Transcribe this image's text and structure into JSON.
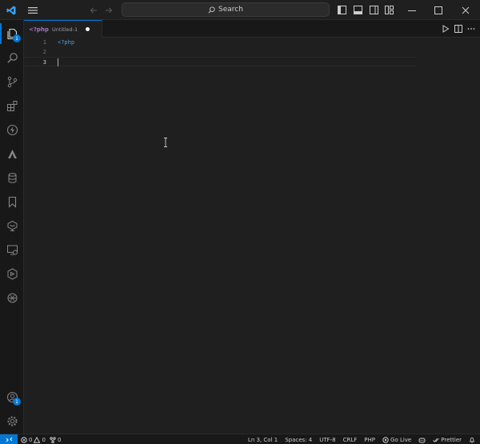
{
  "titlebar": {
    "search_label": "Search",
    "icons": [
      "vscode-logo-icon",
      "menu-icon",
      "back-arrow-icon",
      "forward-arrow-icon",
      "toggle-primary-sidebar-icon",
      "toggle-panel-icon",
      "toggle-secondary-sidebar-icon",
      "customize-layout-icon",
      "minimize-icon",
      "maximize-icon",
      "close-icon"
    ]
  },
  "activitybar": {
    "explorer_badge": "1",
    "accounts_badge": "1",
    "items": [
      "explorer-icon",
      "search-icon",
      "source-control-icon",
      "extensions-icon",
      "thunder-icon",
      "triangle-icon",
      "database-icon",
      "bookmark-icon",
      "cloud-icon",
      "remote-explorer-icon",
      "box-icon",
      "openai-icon",
      "accounts-icon",
      "manage-icon"
    ]
  },
  "tab": {
    "lang": "<?php",
    "title": "Untitled-1",
    "dirty": true
  },
  "editor": {
    "lines": [
      {
        "number": "1",
        "text": "<?php"
      },
      {
        "number": "2",
        "text": ""
      },
      {
        "number": "3",
        "text": ""
      }
    ],
    "current_line": "3"
  },
  "statusbar": {
    "errors": "0",
    "warnings": "0",
    "ports": "0",
    "position": "Ln 3, Col 1",
    "spaces": "Spaces: 4",
    "encoding": "UTF-8",
    "eol": "CRLF",
    "language": "PHP",
    "golive": "Go Live",
    "prettier": "Prettier",
    "colors": {
      "remote_bg": "#0078d4",
      "accent": "#0078d4"
    }
  }
}
